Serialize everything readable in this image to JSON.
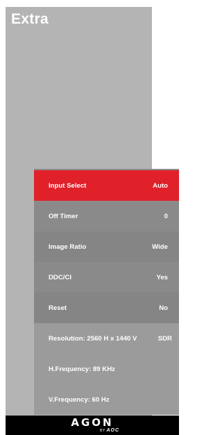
{
  "panel": {
    "title": "Extra"
  },
  "menu": {
    "items": [
      {
        "label": "Input Select",
        "value": "Auto"
      },
      {
        "label": "Off Timer",
        "value": "0"
      },
      {
        "label": "Image Ratio",
        "value": "Wide"
      },
      {
        "label": "DDC/CI",
        "value": "Yes"
      },
      {
        "label": "Reset",
        "value": "No"
      }
    ],
    "info": [
      {
        "label": "Resolution: 2560 H x 1440 V",
        "value": "SDR"
      },
      {
        "label": "H.Frequency: 89 KHz",
        "value": ""
      },
      {
        "label": "V.Frequency: 60 Hz",
        "value": ""
      }
    ]
  },
  "footer": {
    "logo": "AGON",
    "by": "BY",
    "brand": "AOC"
  },
  "colors": {
    "selected": "#e1212a",
    "panel": "#b4b4b4",
    "menu": "#8a8a8a"
  }
}
